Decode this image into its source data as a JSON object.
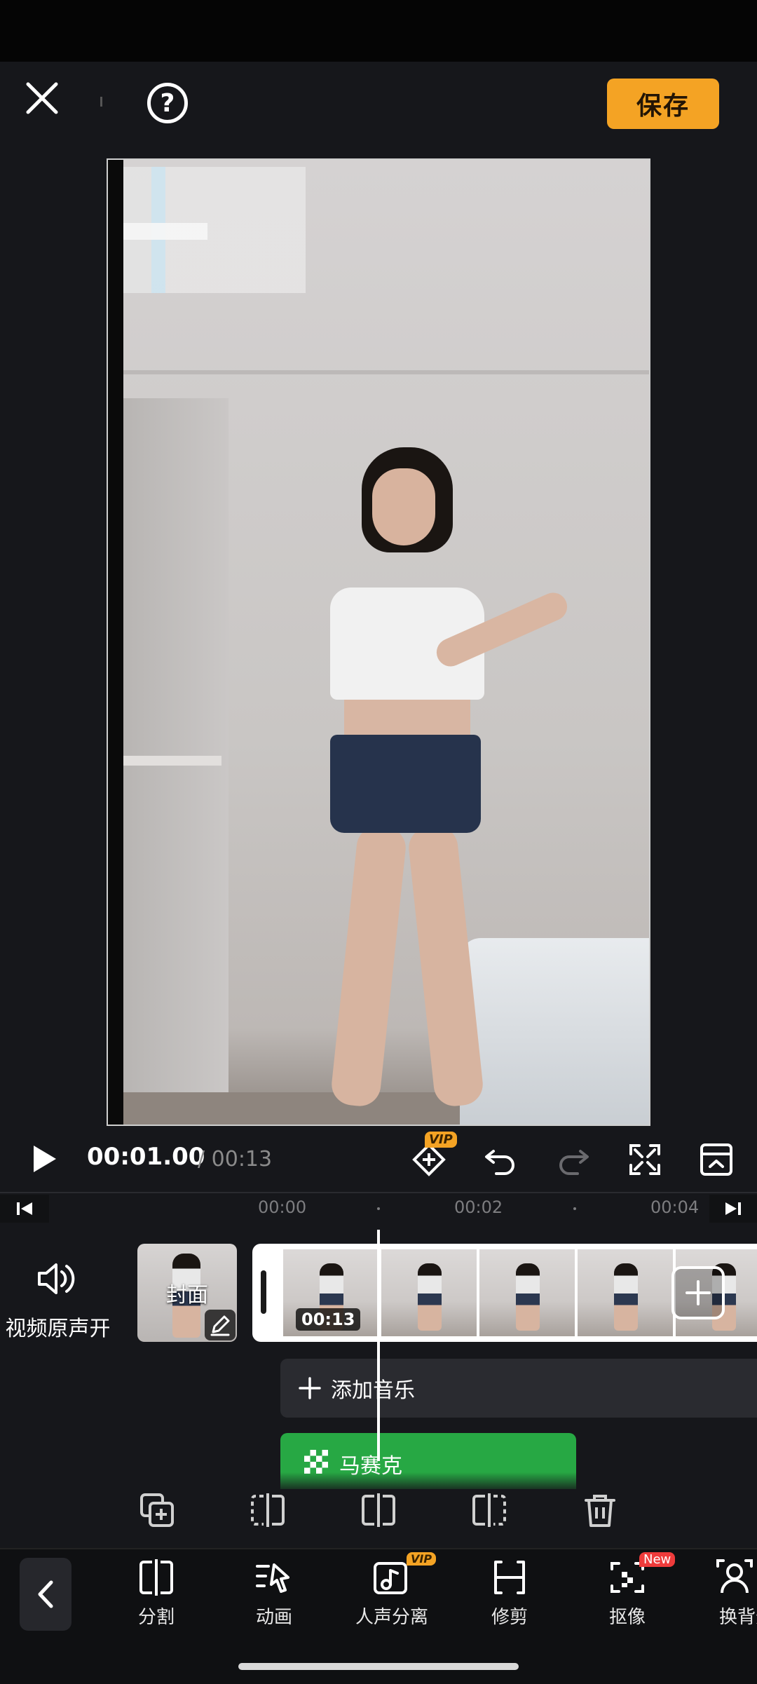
{
  "topbar": {
    "save_label": "保存",
    "help_glyph": "?"
  },
  "playback": {
    "current_time": "00:01.00",
    "total_time": "/ 00:13",
    "vip_label": "VIP"
  },
  "ruler": {
    "ticks": [
      "00:00",
      "00:02",
      "00:04"
    ]
  },
  "timeline": {
    "audio_toggle_label": "视频原声开",
    "cover_label": "封面",
    "clip_duration": "00:13",
    "add_music_label": "添加音乐",
    "mosaic_label": "马赛克"
  },
  "bottom_nav": {
    "items": [
      {
        "label": "分割",
        "icon": "split-icon"
      },
      {
        "label": "动画",
        "icon": "animation-icon"
      },
      {
        "label": "人声分离",
        "icon": "vocal-separation-icon",
        "badge": "VIP"
      },
      {
        "label": "修剪",
        "icon": "trim-icon"
      },
      {
        "label": "抠像",
        "icon": "cutout-icon",
        "badge": "New"
      },
      {
        "label": "换背景",
        "icon": "change-background-icon"
      }
    ]
  },
  "colors": {
    "accent": "#f4a324",
    "background": "#16171b",
    "mosaic_track": "#27a844",
    "new_badge": "#ee3b3b"
  }
}
